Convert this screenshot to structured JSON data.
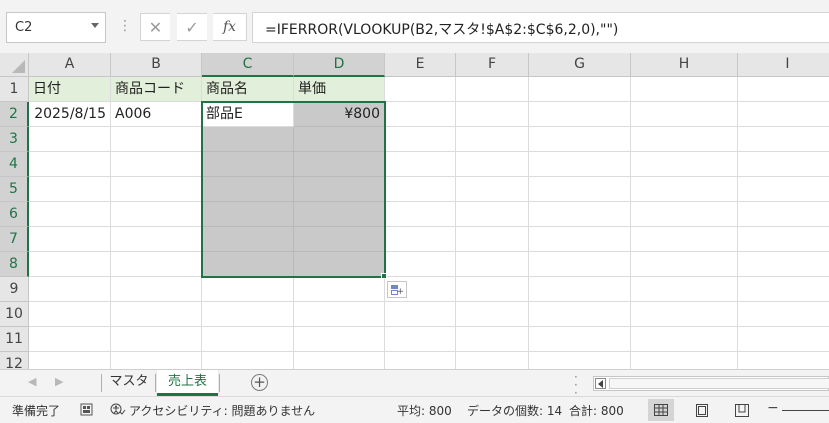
{
  "formula_bar": {
    "name_box": "C2",
    "fx_label": "fx",
    "formula": "=IFERROR(VLOOKUP(B2,マスタ!$A$2:$C$6,2,0),\"\")"
  },
  "columns": [
    "A",
    "B",
    "C",
    "D",
    "E",
    "F",
    "G",
    "H",
    "I"
  ],
  "rows": [
    "1",
    "2",
    "3",
    "4",
    "5",
    "6",
    "7",
    "8",
    "9",
    "10",
    "11",
    "12"
  ],
  "cells": {
    "A1": "日付",
    "B1": "商品コード",
    "C1": "商品名",
    "D1": "単価",
    "A2": "2025/8/15",
    "B2": "A006",
    "C2": "部品E",
    "D2": "¥800"
  },
  "sheets": {
    "items": [
      "マスタ",
      "売上表"
    ],
    "active": "売上表"
  },
  "status": {
    "ready": "準備完了",
    "accessibility": "アクセシビリティ: 問題ありません",
    "average": "平均: 800",
    "count": "データの個数: 14",
    "sum": "合計: 800"
  },
  "colors": {
    "accent": "#217346",
    "header_fill": "#e2efda",
    "selection_fill": "#c9c9c9"
  },
  "icons": [
    "cancel-icon",
    "enter-icon",
    "function-icon",
    "quick-analysis-icon",
    "add-sheet-icon",
    "macro-record-icon",
    "accessibility-icon",
    "normal-view-icon",
    "page-layout-icon",
    "page-break-icon"
  ]
}
